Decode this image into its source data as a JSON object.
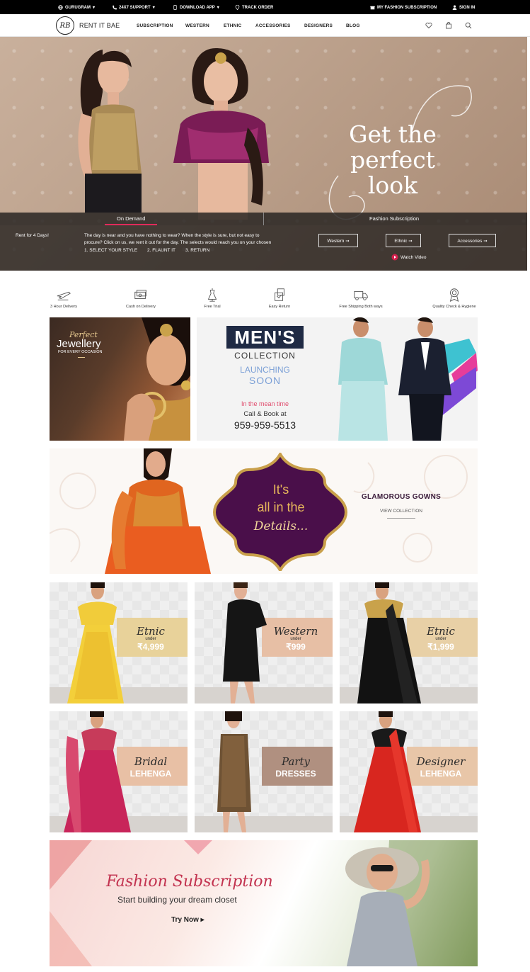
{
  "topbar": {
    "location": "GURUGRAM",
    "support": "24X7 SUPPORT",
    "download": "DOWNLOAD APP",
    "track": "TRACK ORDER",
    "subscription": "MY FASHION SUBSCRIPTION",
    "signin": "SIGN IN"
  },
  "header": {
    "logo_mark": "RB",
    "brand": "RENT IT BAE",
    "nav": [
      "SUBSCRIPTION",
      "WESTERN",
      "ETHNIC",
      "ACCESSORIES",
      "DESIGNERS",
      "BLOG"
    ]
  },
  "hero": {
    "title_line1": "Get the",
    "title_line2": "perfect look",
    "tab_on_demand": "On Demand",
    "tab_subscription": "Fashion Subscription",
    "rent_days": "Rent for 4 Days!",
    "desc_line1": "The day is near and you have nothing to wear? When the style is sure, but not easy to",
    "desc_line2": "procure? Click on us, we rent it out for the day. The selects would reach you on your chosen",
    "step1": "1. SELECT YOUR STYLE",
    "step2": "2. FLAUNT IT",
    "step3": "3. RETURN",
    "btn_western": "Western ➞",
    "btn_ethnic": "Ethnic ➞",
    "btn_accessories": "Accessories ➞",
    "watch_video": "Watch Video"
  },
  "features": [
    {
      "label": "3 Hour Delivery",
      "icon": "airplane-icon"
    },
    {
      "label": "Cash on Delivery",
      "icon": "cash-icon"
    },
    {
      "label": "Free Trial",
      "icon": "dress-form-icon"
    },
    {
      "label": "Easy Return",
      "icon": "return-box-icon"
    },
    {
      "label": "Free Shipping Both ways",
      "icon": "truck-icon"
    },
    {
      "label": "Quality Check & Hygiene",
      "icon": "quality-badge-icon"
    }
  ],
  "jewellery": {
    "script": "Perfect",
    "title": "Jewellery",
    "sub": "FOR EVERY OCCASION"
  },
  "mens": {
    "title": "MEN'S",
    "collection": "COLLECTION",
    "launching": "LAUNCHING",
    "soon": "SOON",
    "meantime": "In the mean time",
    "call": "Call & Book at",
    "phone": "959-959-5513"
  },
  "details": {
    "its": "It's",
    "all": "all in the",
    "details": "Details...",
    "gowns": "GLAMOROUS GOWNS",
    "view": "VIEW COLLECTION"
  },
  "tiles": [
    {
      "t1": "Etnic",
      "t2": "under",
      "t3": "₹4,999",
      "band": "#e8d29a"
    },
    {
      "t1": "Western",
      "t2": "under",
      "t3": "₹999",
      "band": "#e7bfa5"
    },
    {
      "t1": "Etnic",
      "t2": "under",
      "t3": "₹1,999",
      "band": "#e8d0a6"
    },
    {
      "t1": "Bridal",
      "t2": "",
      "t3": "LEHENGA",
      "band": "#e8c0a5"
    },
    {
      "t1": "Party",
      "t2": "",
      "t3": "DRESSES",
      "band": "#b09080"
    },
    {
      "t1": "Designer",
      "t2": "",
      "t3": "LEHENGA",
      "band": "#e8c6a8"
    }
  ],
  "subscription": {
    "title": "Fashion Subscription",
    "sub": "Start building your dream closet",
    "cta": "Try Now ▸"
  }
}
